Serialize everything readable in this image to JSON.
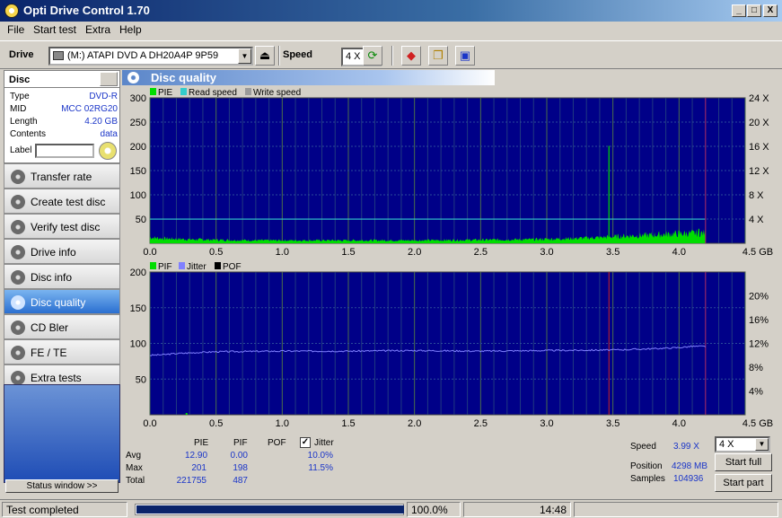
{
  "window": {
    "title": "Opti Drive Control 1.70",
    "min_label": "_",
    "max_label": "□",
    "close_label": "X"
  },
  "menu": {
    "items": [
      "File",
      "Start test",
      "Extra",
      "Help"
    ]
  },
  "toolbar": {
    "drive_label": "Drive",
    "drive_value": "(M:)   ATAPI DVD A  DH20A4P 9P59",
    "speed_label": "Speed",
    "speed_value": "4 X"
  },
  "disc": {
    "header": "Disc",
    "rows": [
      {
        "key": "Type",
        "value": "DVD-R"
      },
      {
        "key": "MID",
        "value": "MCC 02RG20"
      },
      {
        "key": "Length",
        "value": "4.20 GB"
      },
      {
        "key": "Contents",
        "value": "data"
      }
    ],
    "label_key": "Label"
  },
  "nav": {
    "items": [
      {
        "label": "Transfer rate",
        "active": false
      },
      {
        "label": "Create test disc",
        "active": false
      },
      {
        "label": "Verify test disc",
        "active": false
      },
      {
        "label": "Drive info",
        "active": false
      },
      {
        "label": "Disc info",
        "active": false
      },
      {
        "label": "Disc quality",
        "active": true
      },
      {
        "label": "CD Bler",
        "active": false
      },
      {
        "label": "FE / TE",
        "active": false
      },
      {
        "label": "Extra tests",
        "active": false
      }
    ],
    "status_window": "Status window >>"
  },
  "panel": {
    "title": "Disc quality"
  },
  "chart_data": [
    {
      "type": "area",
      "legend": [
        "PIE",
        "Read speed",
        "Write speed"
      ],
      "colors": {
        "PIE": "#00dd00",
        "Read speed": "#33cccc",
        "Write speed": "#9a9a9a",
        "background": "#000088",
        "grid": "#3a6a3a"
      },
      "x_ticks": [
        "0.0",
        "0.5",
        "1.0",
        "1.5",
        "2.0",
        "2.5",
        "3.0",
        "3.5",
        "4.0",
        "4.5 GB"
      ],
      "xlim": [
        0,
        4.5
      ],
      "y_left_ticks": [
        "300",
        "250",
        "200",
        "150",
        "100",
        "50"
      ],
      "ylim": [
        0,
        300
      ],
      "y_right_ticks": [
        "24 X",
        "20 X",
        "16 X",
        "12 X",
        "8 X",
        "4 X"
      ],
      "y2lim": [
        0,
        24
      ],
      "data_end_gb": 4.2,
      "pie_profile": {
        "x": [
          0,
          0.1,
          0.3,
          0.5,
          0.8,
          1.0,
          1.5,
          2.0,
          2.5,
          2.9,
          3.2,
          3.4,
          3.6,
          3.8,
          4.0,
          4.2
        ],
        "y": [
          12,
          10,
          8,
          7,
          6,
          6,
          6,
          6,
          7,
          8,
          10,
          12,
          15,
          17,
          20,
          21
        ]
      },
      "pie_spikes": [
        {
          "x": 3.47,
          "y": 201
        },
        {
          "x": 4.15,
          "y": 30
        }
      ],
      "read_speed_x": 3.99
    },
    {
      "type": "area",
      "legend": [
        "PIF",
        "Jitter",
        "POF"
      ],
      "colors": {
        "PIF": "#00dd00",
        "Jitter": "#8080ff",
        "POF": "#000000",
        "background": "#000088",
        "marker": "#cc2222"
      },
      "x_ticks": [
        "0.0",
        "0.5",
        "1.0",
        "1.5",
        "2.0",
        "2.5",
        "3.0",
        "3.5",
        "4.0",
        "4.5 GB"
      ],
      "xlim": [
        0,
        4.5
      ],
      "y_left_ticks": [
        "200",
        "150",
        "100",
        "50"
      ],
      "ylim": [
        0,
        200
      ],
      "y_right_ticks": [
        "20%",
        "16%",
        "12%",
        "8%",
        "4%"
      ],
      "y2lim": [
        0,
        24
      ],
      "data_end_gb": 4.2,
      "jitter": {
        "x": [
          0,
          0.1,
          0.2,
          0.5,
          1.0,
          1.5,
          2.0,
          2.5,
          3.0,
          3.5,
          3.8,
          4.0,
          4.1,
          4.2
        ],
        "y": [
          10.0,
          10.1,
          10.3,
          10.6,
          10.7,
          10.7,
          10.8,
          10.7,
          10.8,
          10.9,
          11.1,
          11.3,
          11.5,
          11.5
        ]
      },
      "red_marker_gb": 3.47
    }
  ],
  "stats": {
    "col_headers": [
      "PIE",
      "PIF",
      "POF"
    ],
    "jitter_label": "Jitter",
    "jitter_checked": true,
    "rows": [
      {
        "label": "Avg",
        "pie": "12.90",
        "pif": "0.00",
        "jitter": "10.0%"
      },
      {
        "label": "Max",
        "pie": "201",
        "pif": "198",
        "jitter": "11.5%"
      },
      {
        "label": "Total",
        "pie": "221755",
        "pif": "487",
        "jitter": ""
      }
    ],
    "speed_label": "Speed",
    "speed_value": "3.99 X",
    "position_label": "Position",
    "position_value": "4298 MB",
    "samples_label": "Samples",
    "samples_value": "104936",
    "speed_select": "4 X",
    "start_full": "Start full",
    "start_part": "Start part"
  },
  "statusbar": {
    "status_text": "Test completed",
    "progress_percent": 100,
    "progress_label": "100.0%",
    "elapsed": "14:48"
  }
}
